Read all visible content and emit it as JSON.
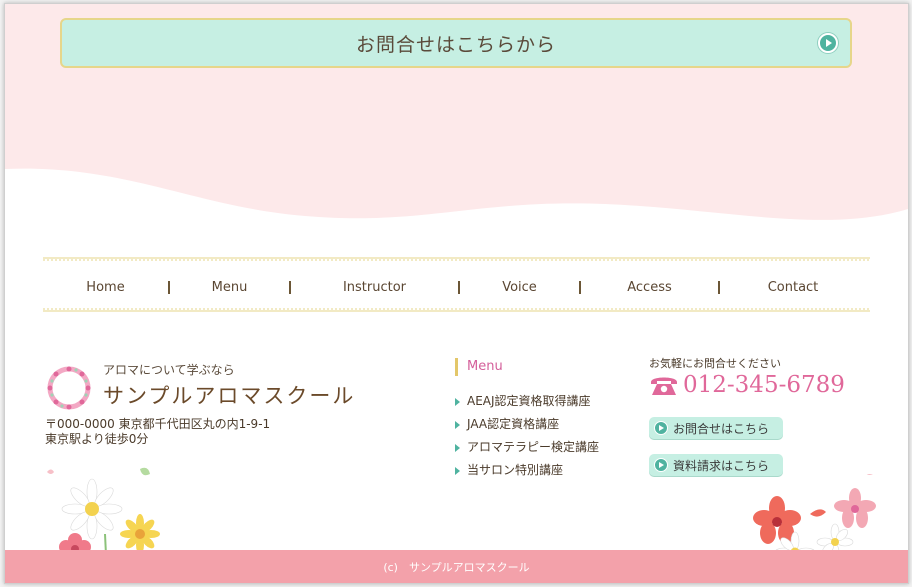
{
  "contact_banner": {
    "label": "お問合せはこちらから"
  },
  "nav": {
    "items": [
      "Home",
      "Menu",
      "Instructor",
      "Voice",
      "Access",
      "Contact"
    ]
  },
  "school": {
    "tagline": "アロマについて学ぶなら",
    "name": "サンプルアロマスクール",
    "address_line1": "〒000-0000 東京都千代田区丸の内1-9-1",
    "address_line2": "東京駅より徒歩0分"
  },
  "footer_menu": {
    "title": "Menu",
    "items": [
      "AEAJ認定資格取得講座",
      "JAA認定資格講座",
      "アロマテラピー検定講座",
      "当サロン特別講座"
    ]
  },
  "contact": {
    "label": "お気軽にお問合せください",
    "phone": "012-345-6789",
    "phone_icon": "telephone-icon",
    "inquiry_button": "お問合せはこちら",
    "request_button": "資料請求はこちら"
  },
  "footer": {
    "copyright": "(c)　サンプルアロマスクール"
  },
  "colors": {
    "mint": "#c6efe3",
    "pink_bg": "#fde9ea",
    "footer_pink": "#f3a1aa",
    "phone_pink": "#e0689a",
    "gold": "#e3c76a"
  }
}
